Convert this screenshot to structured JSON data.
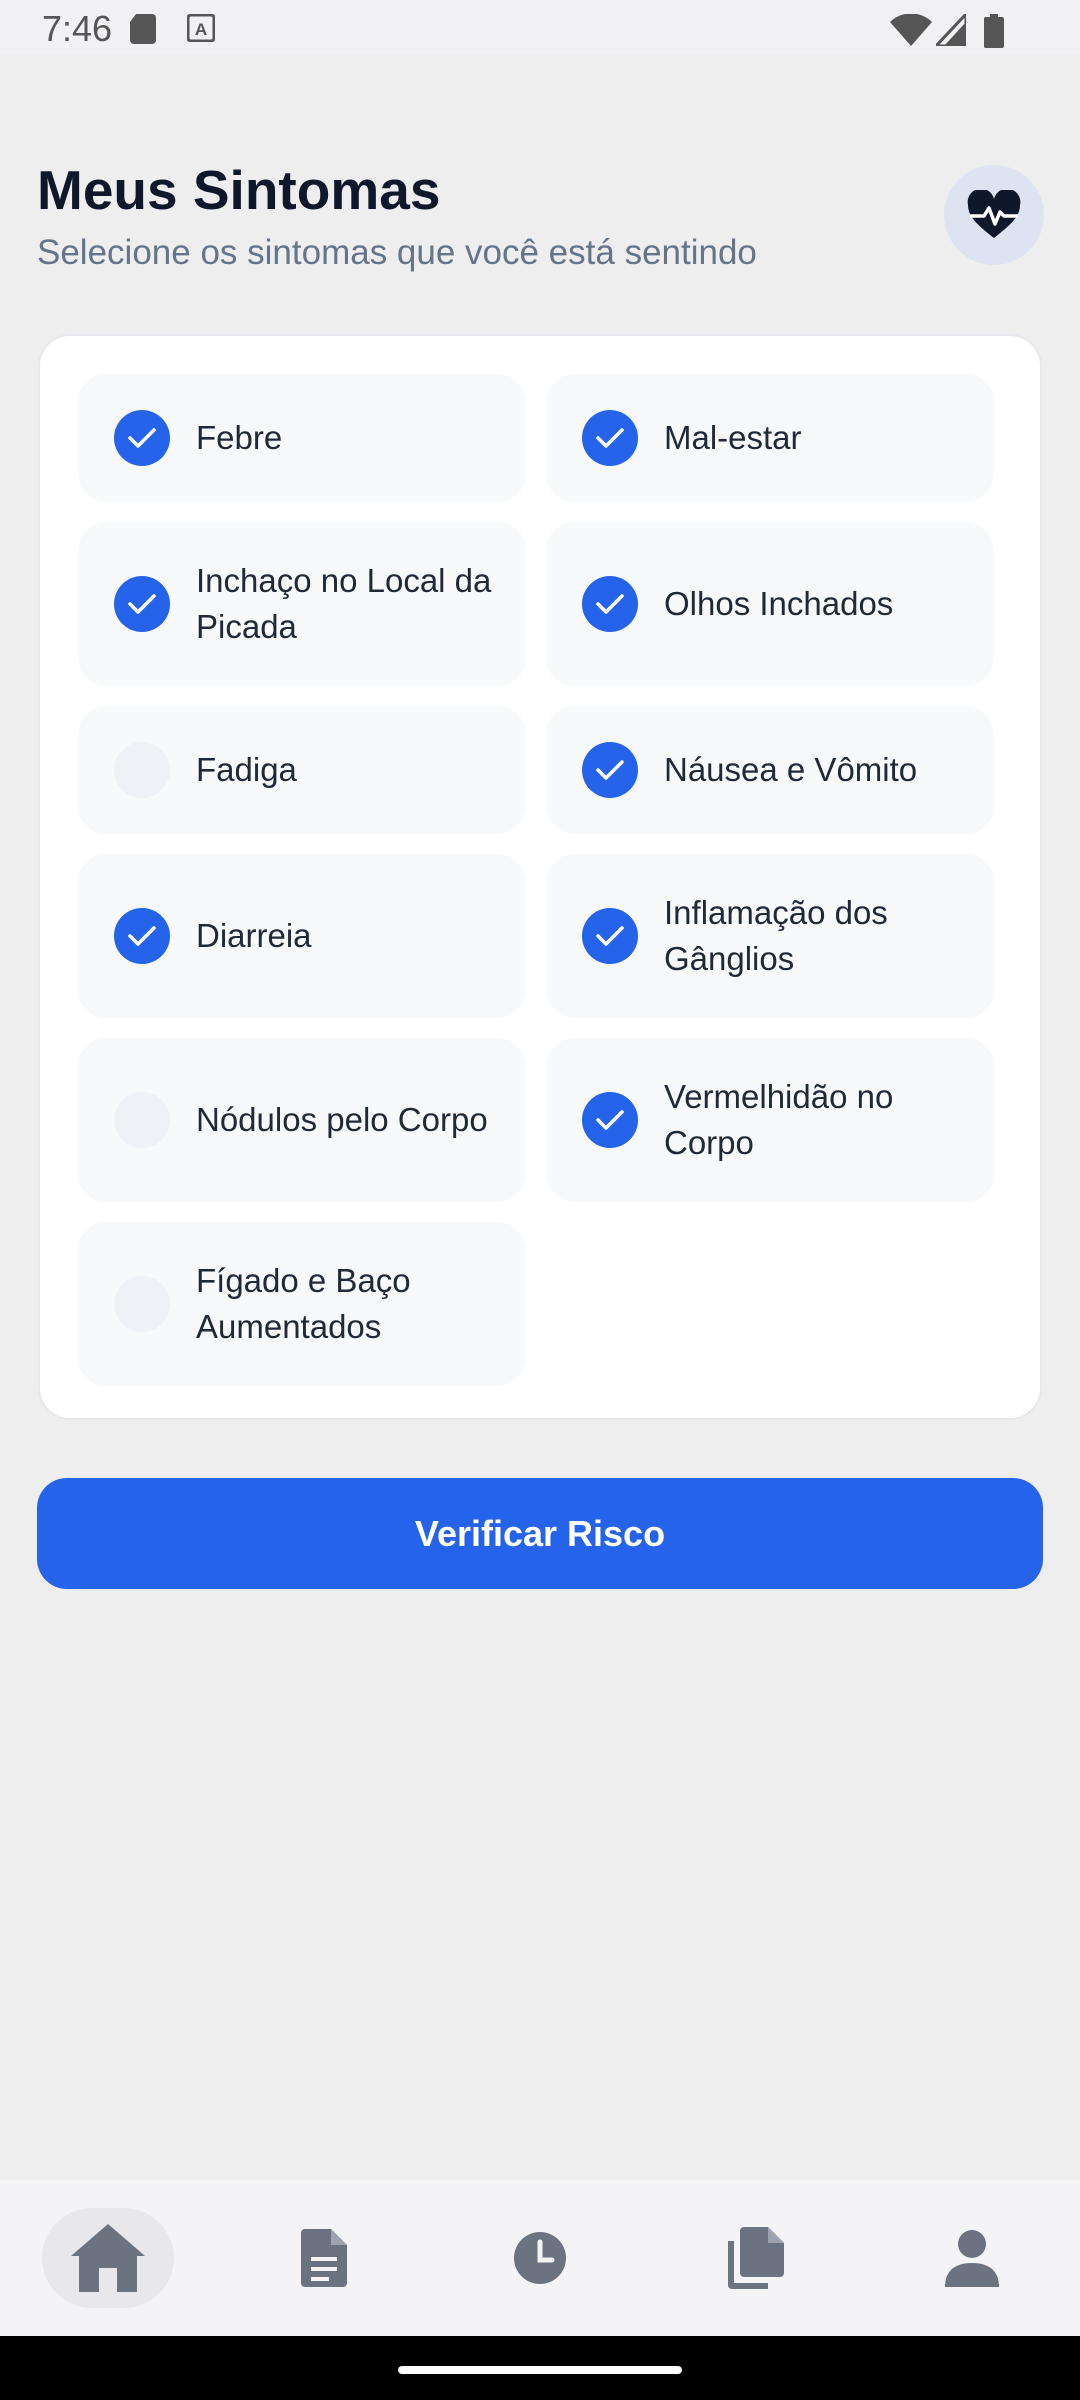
{
  "status_bar": {
    "time": "7:46"
  },
  "header": {
    "title": "Meus Sintomas",
    "subtitle": "Selecione os sintomas que você está sentindo"
  },
  "symptoms": [
    {
      "label": "Febre",
      "checked": true
    },
    {
      "label": "Mal-estar",
      "checked": true
    },
    {
      "label": "Inchaço no Local da Picada",
      "checked": true
    },
    {
      "label": "Olhos Inchados",
      "checked": true
    },
    {
      "label": "Fadiga",
      "checked": false
    },
    {
      "label": "Náusea e Vômito",
      "checked": true
    },
    {
      "label": "Diarreia",
      "checked": true
    },
    {
      "label": "Inflamação dos Gânglios",
      "checked": true
    },
    {
      "label": "Nódulos pelo Corpo",
      "checked": false
    },
    {
      "label": "Vermelhidão no Corpo",
      "checked": true
    },
    {
      "label": "Fígado e Baço Aumentados",
      "checked": false
    }
  ],
  "cta": {
    "label": "Verificar Risco"
  },
  "bottom_nav": [
    "home-icon",
    "document-icon",
    "clock-icon",
    "files-icon",
    "profile-icon"
  ],
  "colors": {
    "accent": "#2563eb",
    "background": "#eeeeef",
    "card": "#ffffff"
  }
}
